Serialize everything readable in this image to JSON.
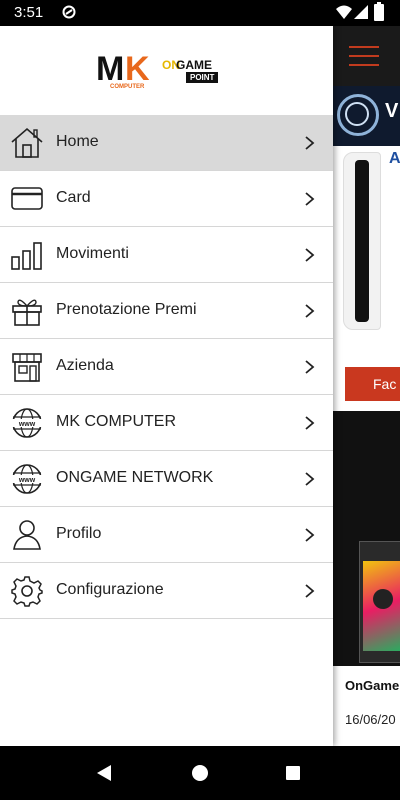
{
  "status_bar": {
    "time": "3:51"
  },
  "drawer": {
    "logos": {
      "mk_letters_m": "M",
      "mk_letters_k": "K",
      "mk_sub": "COMPUTER",
      "ongame_a": "ON",
      "ongame_b": "GAME",
      "ongame_point": "POINT"
    },
    "menu": [
      {
        "label": "Home",
        "icon": "home-icon",
        "active": true
      },
      {
        "label": "Card",
        "icon": "card-icon",
        "active": false
      },
      {
        "label": "Movimenti",
        "icon": "bar-chart-icon",
        "active": false
      },
      {
        "label": "Prenotazione Premi",
        "icon": "gift-icon",
        "active": false
      },
      {
        "label": "Azienda",
        "icon": "store-icon",
        "active": false
      },
      {
        "label": "MK COMPUTER",
        "icon": "www-globe-icon",
        "active": false
      },
      {
        "label": "ONGAME NETWORK",
        "icon": "www-globe-icon",
        "active": false
      },
      {
        "label": "Profilo",
        "icon": "person-icon",
        "active": false
      },
      {
        "label": "Configurazione",
        "icon": "gear-icon",
        "active": false
      }
    ]
  },
  "background_app": {
    "banner_text": "V",
    "product_text": "A",
    "button_label": "Fac",
    "news_title": "OnGame",
    "news_date": "16/06/20"
  },
  "colors": {
    "accent": "#c9381f",
    "active_row": "#d9d9d9",
    "mk_orange": "#e8681c"
  }
}
